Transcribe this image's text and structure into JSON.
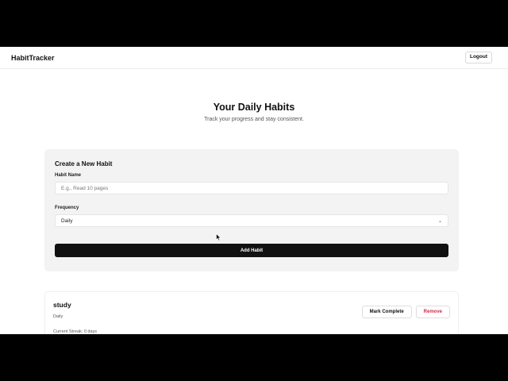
{
  "navbar": {
    "brand": "HabitTracker",
    "logout_label": "Logout"
  },
  "hero": {
    "title": "Your Daily Habits",
    "subtitle": "Track your progress and stay consistent."
  },
  "form": {
    "heading": "Create a New Habit",
    "name_label": "Habit Name",
    "name_placeholder": "E.g., Read 10 pages",
    "frequency_label": "Frequency",
    "frequency_value": "Daily",
    "submit_label": "Add Habit"
  },
  "habits": [
    {
      "name": "study",
      "frequency": "Daily",
      "streak_text": "Current Streak: 0 days",
      "mark_label": "Mark Complete",
      "remove_label": "Remove"
    }
  ],
  "icons": {
    "select_arrow": "chevron-down-icon",
    "pointer": "mouse-cursor-icon"
  },
  "colors": {
    "primary": "#111111",
    "danger": "#d0294b",
    "panel": "#f3f3f3"
  }
}
